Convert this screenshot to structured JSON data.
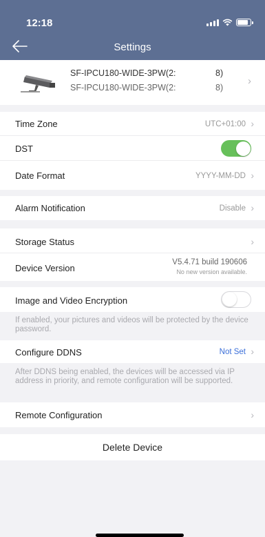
{
  "status_bar": {
    "time": "12:18"
  },
  "nav": {
    "title": "Settings"
  },
  "device": {
    "name_line1": "SF-IPCU180-WIDE-3PW(2:",
    "name_line1_suffix": "8)",
    "name_line2": "SF-IPCU180-WIDE-3PW(2:",
    "name_line2_suffix": "8)"
  },
  "settings": {
    "time_zone": {
      "label": "Time Zone",
      "value": "UTC+01:00"
    },
    "dst": {
      "label": "DST",
      "enabled": true
    },
    "date_format": {
      "label": "Date Format",
      "value": "YYYY-MM-DD"
    },
    "alarm_notification": {
      "label": "Alarm Notification",
      "value": "Disable"
    },
    "storage_status": {
      "label": "Storage Status"
    },
    "device_version": {
      "label": "Device Version",
      "value": "V5.4.71 build 190606",
      "sub": "No new version available."
    },
    "encryption": {
      "label": "Image and Video Encryption",
      "enabled": false,
      "desc": "If enabled, your pictures and videos will be protected by the device password."
    },
    "ddns": {
      "label": "Configure DDNS",
      "value": "Not Set",
      "desc": "After DDNS being enabled, the devices will be accessed via IP address in priority, and remote configuration will be supported."
    },
    "remote_config": {
      "label": "Remote Configuration"
    }
  },
  "actions": {
    "delete_device": "Delete Device"
  },
  "colors": {
    "header": "#5d6f93",
    "toggle_on": "#67c05a",
    "link_blue": "#3b6fd9",
    "background": "#f2f2f5"
  }
}
